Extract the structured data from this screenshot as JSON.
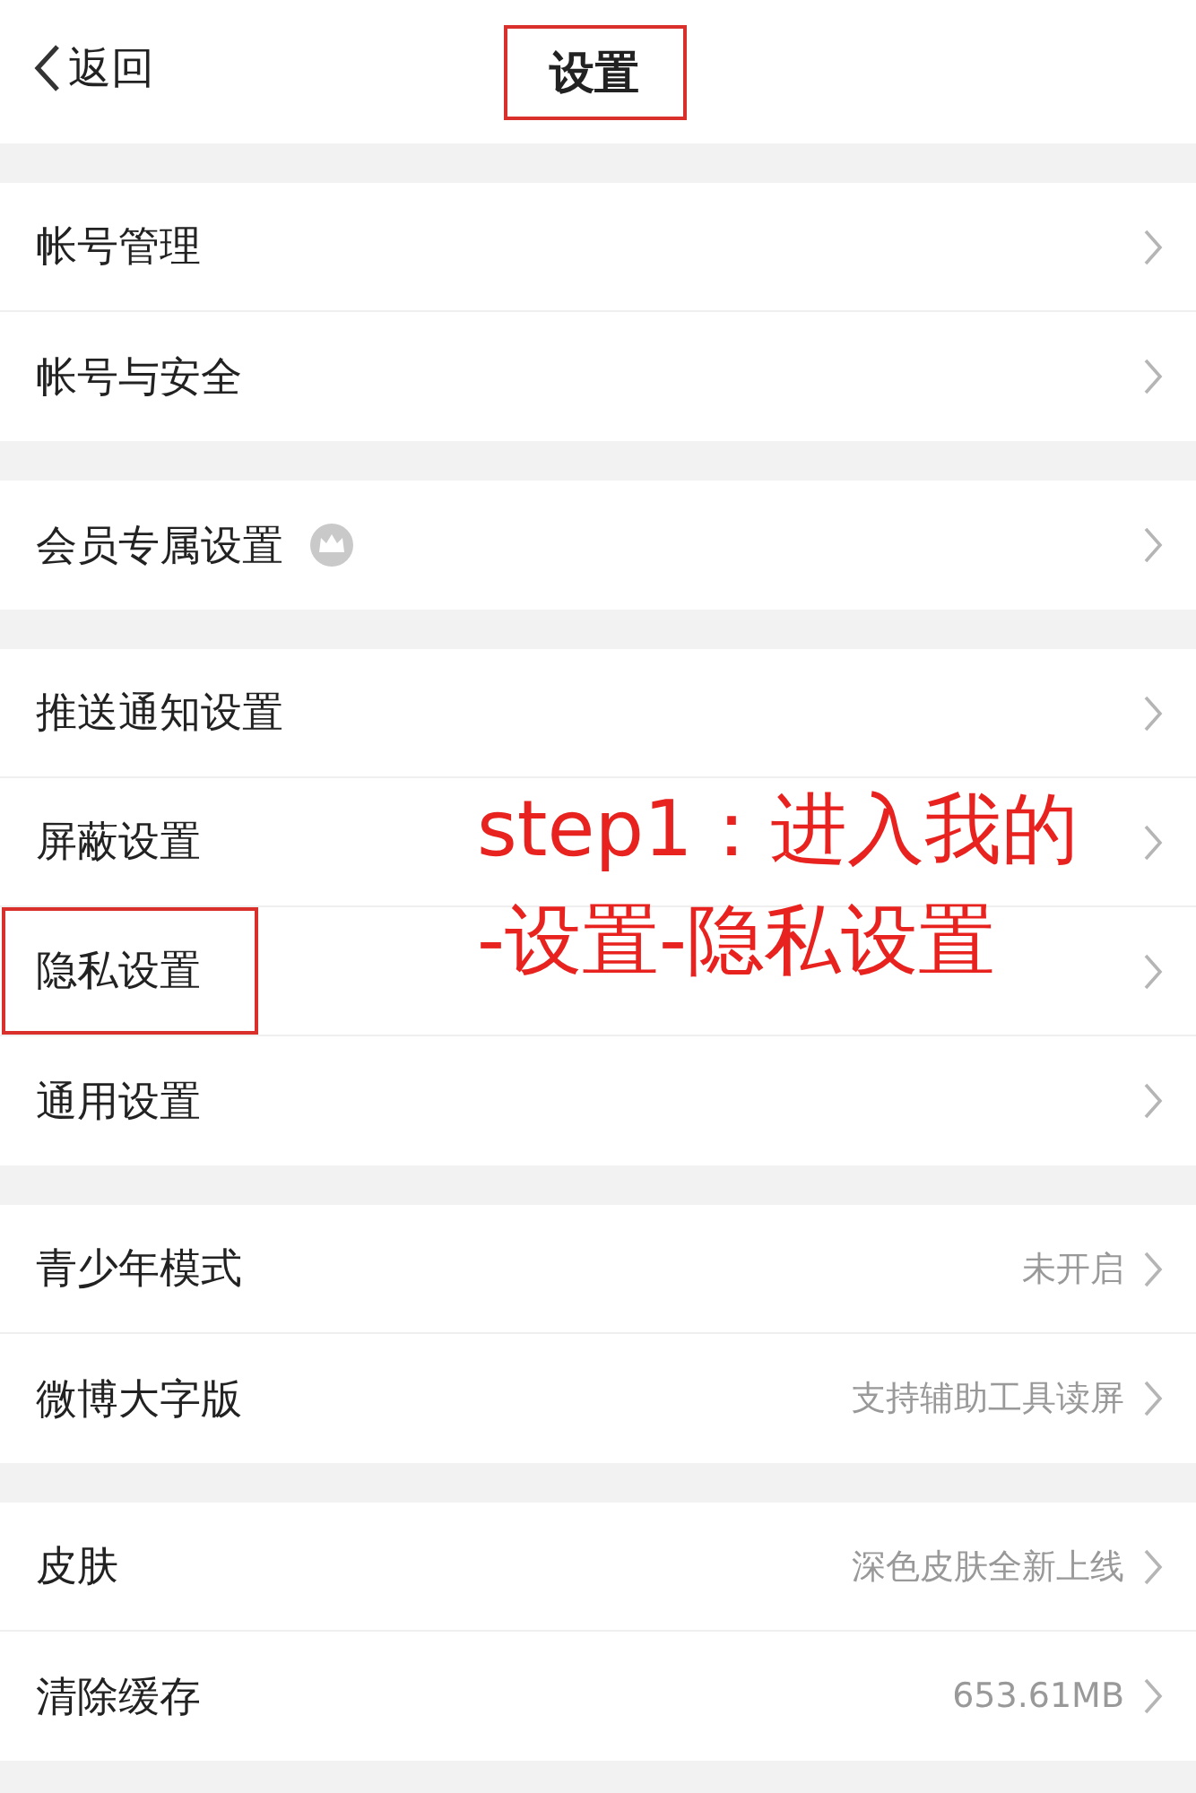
{
  "header": {
    "back": "返回",
    "title": "设置",
    "title_highlighted": true
  },
  "sections": [
    {
      "items": [
        {
          "label": "帐号管理",
          "kind": "plain",
          "highlighted": false
        },
        {
          "label": "帐号与安全",
          "kind": "plain",
          "highlighted": false
        }
      ]
    },
    {
      "items": [
        {
          "label": "会员专属设置",
          "kind": "crown",
          "highlighted": false
        }
      ]
    },
    {
      "items": [
        {
          "label": "推送通知设置",
          "kind": "plain",
          "highlighted": false
        },
        {
          "label": "屏蔽设置",
          "kind": "plain",
          "highlighted": false
        },
        {
          "label": "隐私设置",
          "kind": "plain",
          "highlighted": true
        },
        {
          "label": "通用设置",
          "kind": "plain",
          "highlighted": false
        }
      ]
    },
    {
      "items": [
        {
          "label": "青少年模式",
          "kind": "plain",
          "highlighted": false,
          "value": "未开启"
        },
        {
          "label": "微博大字版",
          "kind": "plain",
          "highlighted": false,
          "value": "支持辅助工具读屏"
        }
      ]
    },
    {
      "items": [
        {
          "label": "皮肤",
          "kind": "plain",
          "highlighted": false,
          "value": "深色皮肤全新上线"
        },
        {
          "label": "清除缓存",
          "kind": "plain",
          "highlighted": false,
          "value": "653.61MB"
        }
      ]
    }
  ],
  "annotation": {
    "lines": [
      "step1：进入我的",
      "-设置-隐私设置"
    ]
  }
}
